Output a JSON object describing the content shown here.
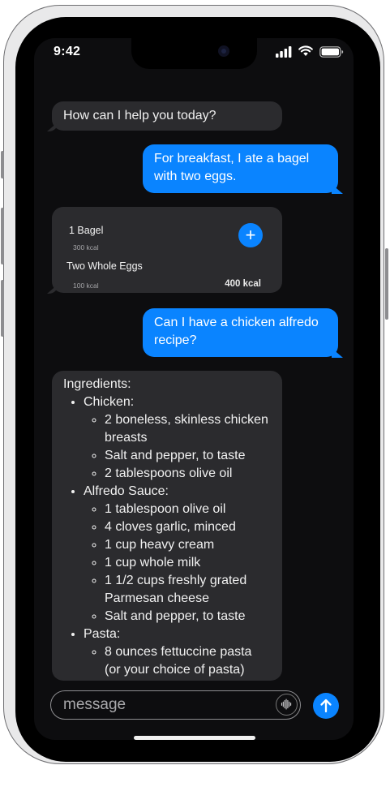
{
  "status_bar": {
    "time": "9:42"
  },
  "messages": {
    "greeting": "How can I help you today?",
    "user_breakfast": "For breakfast, I ate a bagel with two eggs.",
    "user_recipe": "Can I have a chicken alfredo recipe?"
  },
  "nutrition_card": {
    "items": [
      {
        "name": "1 Bagel",
        "kcal": "300 kcal"
      },
      {
        "name": "Two Whole Eggs",
        "kcal": "100 kcal"
      }
    ],
    "total": "400 kcal"
  },
  "recipe": {
    "title": "Ingredients:",
    "sections": [
      {
        "name": "Chicken:",
        "items": [
          "2 boneless, skinless chicken breasts",
          "Salt and pepper, to taste",
          "2 tablespoons olive oil"
        ]
      },
      {
        "name": "Alfredo Sauce:",
        "items": [
          "1 tablespoon olive oil",
          "4 cloves garlic, minced",
          "1 cup heavy cream",
          "1 cup whole milk",
          "1 1/2 cups freshly grated Parmesan cheese",
          "Salt and pepper, to taste"
        ]
      },
      {
        "name": "Pasta:",
        "items": [
          "8 ounces fettuccine pasta (or your choice of pasta)"
        ]
      }
    ]
  },
  "composer": {
    "placeholder": "message"
  },
  "icons": {
    "voice": "waveform-icon",
    "send": "arrow-up-icon",
    "add": "plus-icon"
  },
  "colors": {
    "accent": "#0a84ff",
    "ai_bubble": "#2b2b2e",
    "background": "#0d0d0f"
  }
}
